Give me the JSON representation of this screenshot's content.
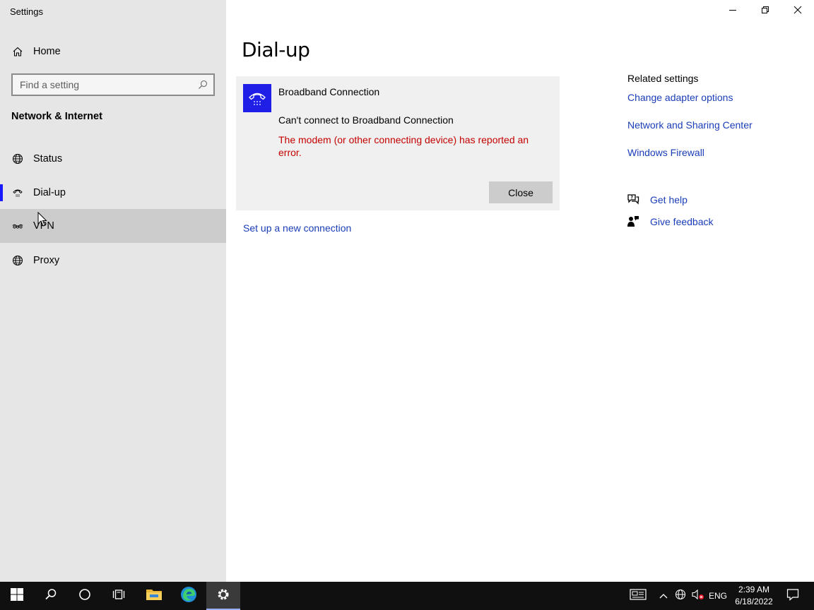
{
  "window": {
    "title": "Settings",
    "controls": {
      "minimize": "minimize-icon",
      "restore": "restore-icon",
      "close": "close-icon"
    }
  },
  "sidebar": {
    "home_label": "Home",
    "search_placeholder": "Find a setting",
    "section_heading": "Network & Internet",
    "items": [
      {
        "label": "Status",
        "icon": "globe-status-icon"
      },
      {
        "label": "Dial-up",
        "icon": "dialup-phone-icon",
        "selected": true
      },
      {
        "label": "VPN",
        "icon": "vpn-icon",
        "hovered": true
      },
      {
        "label": "Proxy",
        "icon": "globe-icon"
      }
    ]
  },
  "main": {
    "title": "Dial-up",
    "connection": {
      "name": "Broadband Connection",
      "status": "Can't connect to Broadband Connection",
      "error": "The modem (or other connecting device) has reported an error.",
      "close_label": "Close"
    },
    "new_connection_link": "Set up a new connection"
  },
  "related": {
    "heading": "Related settings",
    "links": [
      "Change adapter options",
      "Network and Sharing Center",
      "Windows Firewall"
    ],
    "help_label": "Get help",
    "feedback_label": "Give feedback"
  },
  "taskbar": {
    "language": "ENG",
    "time": "2:39 AM",
    "date": "6/18/2022"
  },
  "colors": {
    "accent": "#1a1aff",
    "link": "#1a3db8",
    "error": "#c50000",
    "sidebar_bg": "#e6e6e6",
    "taskbar_bg": "#101010"
  }
}
